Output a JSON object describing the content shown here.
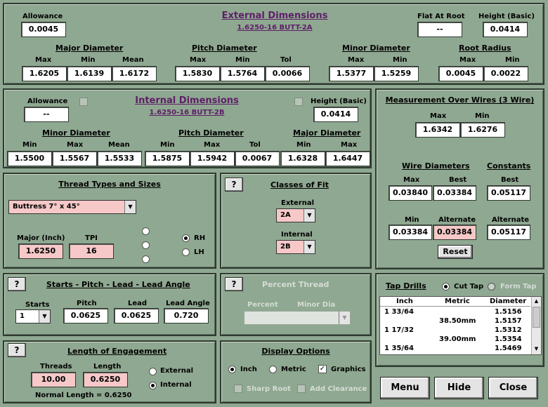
{
  "external": {
    "title": "External Dimensions",
    "subtitle": "1.6250-16 BUTT-2A",
    "allowance_label": "Allowance",
    "allowance": "0.0045",
    "flat_at_root_label": "Flat At Root",
    "flat_at_root": "--",
    "height_label": "Height (Basic)",
    "height": "0.0414",
    "major": {
      "title": "Major Diameter",
      "max_label": "Max",
      "min_label": "Min",
      "mean_label": "Mean",
      "max": "1.6205",
      "min": "1.6139",
      "mean": "1.6172"
    },
    "pitch": {
      "title": "Pitch Diameter",
      "max_label": "Max",
      "min_label": "Min",
      "tol_label": "Tol",
      "max": "1.5830",
      "min": "1.5764",
      "tol": "0.0066"
    },
    "minor": {
      "title": "Minor Diameter",
      "max_label": "Max",
      "min_label": "Min",
      "max": "1.5377",
      "min": "1.5259"
    },
    "root": {
      "title": "Root Radius",
      "max_label": "Max",
      "min_label": "Min",
      "max": "0.0045",
      "min": "0.0022"
    }
  },
  "internal": {
    "title": "Internal Dimensions",
    "subtitle": "1.6250-16 BUTT-2B",
    "allowance_label": "Allowance",
    "allowance": "--",
    "height_label": "Height (Basic)",
    "height": "0.0414",
    "minor": {
      "title": "Minor Diameter",
      "min_label": "Min",
      "max_label": "Max",
      "mean_label": "Mean",
      "min": "1.5500",
      "max": "1.5567",
      "mean": "1.5533"
    },
    "pitch": {
      "title": "Pitch Diameter",
      "min_label": "Min",
      "max_label": "Max",
      "tol_label": "Tol",
      "min": "1.5875",
      "max": "1.5942",
      "tol": "0.0067"
    },
    "major": {
      "title": "Major Diameter",
      "min_label": "Min",
      "max_label": "Max",
      "min": "1.6328",
      "max": "1.6447"
    }
  },
  "wires": {
    "title": "Measurement Over Wires (3 Wire)",
    "max_label": "Max",
    "min_label": "Min",
    "max": "1.6342",
    "min": "1.6276",
    "wire_title": "Wire Diameters",
    "const_title": "Constants",
    "best_label": "Best",
    "alt_label": "Alternate",
    "wire_max": "0.03840",
    "wire_best": "0.03384",
    "const_best": "0.05117",
    "wire_min": "0.03384",
    "wire_alt": "0.03384",
    "const_alt": "0.05117",
    "reset": "Reset"
  },
  "thread_types": {
    "title": "Thread Types and Sizes",
    "selected": "Buttress   7° x 45°",
    "major_label": "Major (Inch)",
    "major": "1.6250",
    "tpi_label": "TPI",
    "tpi": "16",
    "rh": "RH",
    "lh": "LH"
  },
  "classes": {
    "title": "Classes of Fit",
    "help": "?",
    "external_label": "External",
    "external": "2A",
    "internal_label": "Internal",
    "internal": "2B"
  },
  "spll": {
    "title": "Starts - Pitch - Lead - Lead Angle",
    "help": "?",
    "starts_label": "Starts",
    "pitch_label": "Pitch",
    "lead_label": "Lead",
    "angle_label": "Lead Angle",
    "starts": "1",
    "pitch": "0.0625",
    "lead": "0.0625",
    "angle": "0.720"
  },
  "percent": {
    "title": "Percent Thread",
    "help": "?",
    "percent_label": "Percent",
    "minor_label": "Minor Dia"
  },
  "tap": {
    "title": "Tap Drills",
    "cut_tap": "Cut Tap",
    "form_tap": "Form Tap",
    "headers": [
      "Inch",
      "Metric",
      "Diameter"
    ],
    "rows": [
      {
        "inch": "1 33/64",
        "metric": "",
        "dia": "1.5156"
      },
      {
        "inch": "",
        "metric": "38.50mm",
        "dia": "1.5157"
      },
      {
        "inch": "1 17/32",
        "metric": "",
        "dia": "1.5312"
      },
      {
        "inch": "",
        "metric": "39.00mm",
        "dia": "1.5354"
      },
      {
        "inch": "1 35/64",
        "metric": "",
        "dia": "1.5469"
      }
    ]
  },
  "engagement": {
    "title": "Length of Engagement",
    "help": "?",
    "threads_label": "Threads",
    "length_label": "Length",
    "threads": "10.00",
    "length": "0.6250",
    "external": "External",
    "internal": "Internal",
    "normal": "Normal Length = 0.6250"
  },
  "display": {
    "title": "Display Options",
    "inch": "Inch",
    "metric": "Metric",
    "graphics": "Graphics",
    "sharp_root": "Sharp Root",
    "add_clearance": "Add Clearance"
  },
  "buttons": {
    "menu": "Menu",
    "hide": "Hide",
    "close": "Close"
  }
}
